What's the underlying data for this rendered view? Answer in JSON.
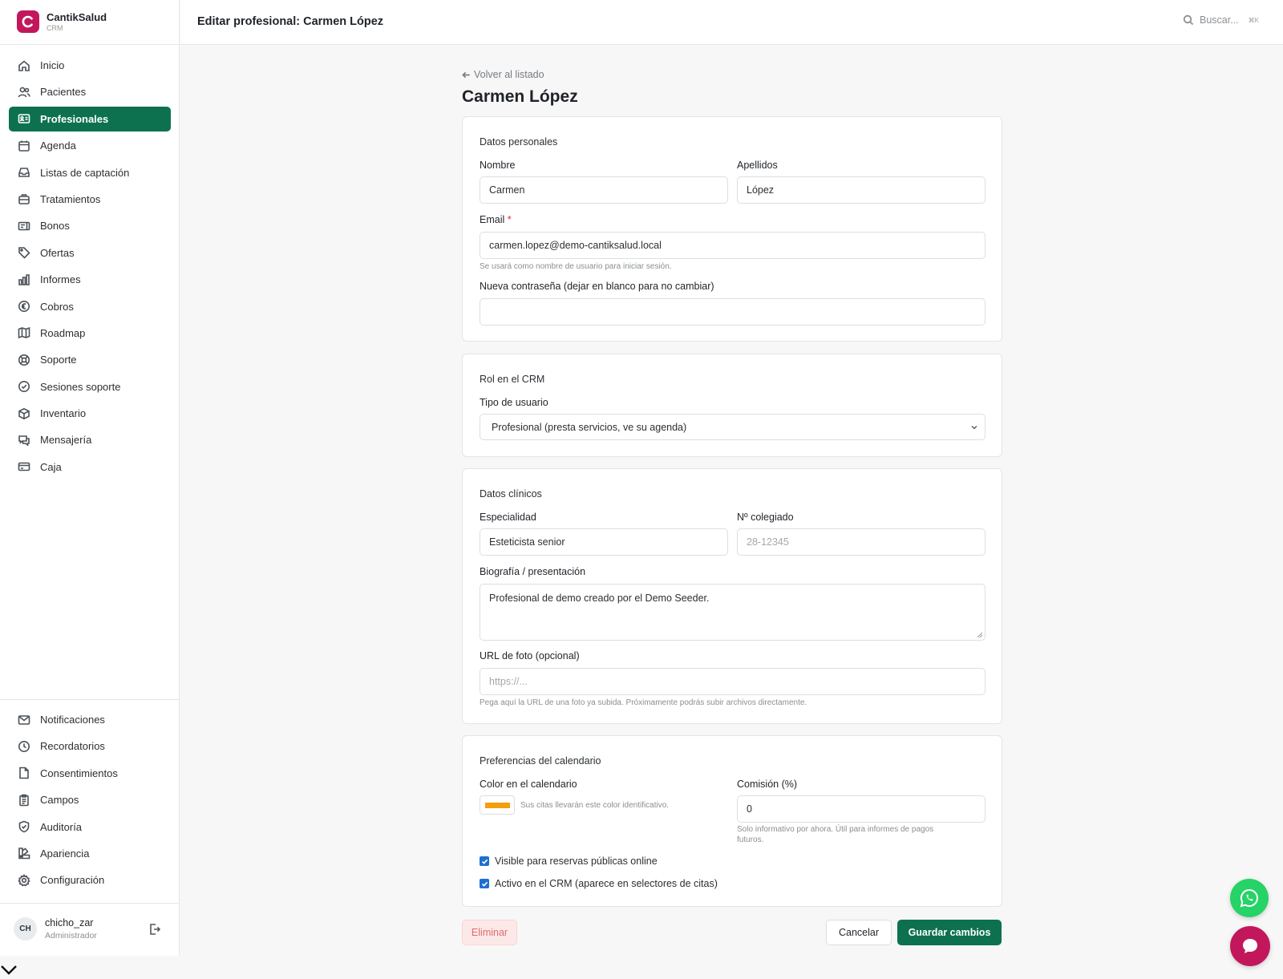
{
  "brand": {
    "name": "CantikSalud",
    "sub": "CRM",
    "color": "#c2185b"
  },
  "header": {
    "title": "Editar profesional: Carmen López",
    "search_placeholder": "Buscar...",
    "shortcut": "⌘K"
  },
  "sidebar": {
    "items": [
      {
        "label": "Inicio",
        "icon": "home-icon"
      },
      {
        "label": "Pacientes",
        "icon": "users-icon"
      },
      {
        "label": "Profesionales",
        "icon": "id-card-icon",
        "active": true
      },
      {
        "label": "Agenda",
        "icon": "calendar-icon"
      },
      {
        "label": "Listas de captación",
        "icon": "inbox-icon"
      },
      {
        "label": "Tratamientos",
        "icon": "briefcase-icon"
      },
      {
        "label": "Bonos",
        "icon": "ticket-icon"
      },
      {
        "label": "Ofertas",
        "icon": "tag-icon"
      },
      {
        "label": "Informes",
        "icon": "bar-chart-icon"
      },
      {
        "label": "Cobros",
        "icon": "euro-icon"
      },
      {
        "label": "Roadmap",
        "icon": "map-icon"
      },
      {
        "label": "Soporte",
        "icon": "lifebuoy-icon"
      },
      {
        "label": "Sesiones soporte",
        "icon": "check-circle-icon"
      },
      {
        "label": "Inventario",
        "icon": "box-icon"
      },
      {
        "label": "Mensajería",
        "icon": "chat-icon"
      },
      {
        "label": "Caja",
        "icon": "credit-card-icon"
      }
    ],
    "bottom_items": [
      {
        "label": "Notificaciones",
        "icon": "mail-icon"
      },
      {
        "label": "Recordatorios",
        "icon": "clock-icon"
      },
      {
        "label": "Consentimientos",
        "icon": "file-icon"
      },
      {
        "label": "Campos",
        "icon": "clipboard-icon"
      },
      {
        "label": "Auditoría",
        "icon": "shield-check-icon"
      },
      {
        "label": "Apariencia",
        "icon": "palette-icon"
      },
      {
        "label": "Configuración",
        "icon": "gear-icon"
      }
    ]
  },
  "user": {
    "initials": "CH",
    "name": "chicho_zar",
    "role": "Administrador"
  },
  "main": {
    "back_label": "Volver al listado",
    "heading": "Carmen López"
  },
  "personal": {
    "title": "Datos personales",
    "nombre_label": "Nombre",
    "nombre_value": "Carmen",
    "apellidos_label": "Apellidos",
    "apellidos_value": "López",
    "email_label": "Email",
    "email_required": "*",
    "email_value": "carmen.lopez@demo-cantiksalud.local",
    "email_help": "Se usará como nombre de usuario para iniciar sesión.",
    "password_label": "Nueva contraseña (dejar en blanco para no cambiar)",
    "password_value": ""
  },
  "role": {
    "title": "Rol en el CRM",
    "type_label": "Tipo de usuario",
    "type_value": "Profesional (presta servicios, ve su agenda)"
  },
  "clinical": {
    "title": "Datos clínicos",
    "especialidad_label": "Especialidad",
    "especialidad_value": "Esteticista senior",
    "colegiado_label": "Nº colegiado",
    "colegiado_placeholder": "28-12345",
    "bio_label": "Biografía / presentación",
    "bio_value": "Profesional de demo creado por el Demo Seeder.",
    "photo_label": "URL de foto (opcional)",
    "photo_placeholder": "https://...",
    "photo_help": "Pega aquí la URL de una foto ya subida. Próximamente podrás subir archivos directamente."
  },
  "calendar": {
    "title": "Preferencias del calendario",
    "color_label": "Color en el calendario",
    "color_value": "#f59e0b",
    "color_help": "Sus citas llevarán este color identificativo.",
    "commission_label": "Comisión (%)",
    "commission_value": "0",
    "commission_help_1": "Solo informativo por ahora. Útil para informes de pagos",
    "commission_help_2": "futuros.",
    "visible_label": "Visible para reservas públicas online",
    "visible_checked": true,
    "active_label": "Activo en el CRM (aparece en selectores de citas)",
    "active_checked": true
  },
  "actions": {
    "delete": "Eliminar",
    "cancel": "Cancelar",
    "save": "Guardar cambios"
  },
  "colors": {
    "accent": "#0d7150",
    "whatsapp": "#25d366",
    "chat": "#c2185b"
  }
}
